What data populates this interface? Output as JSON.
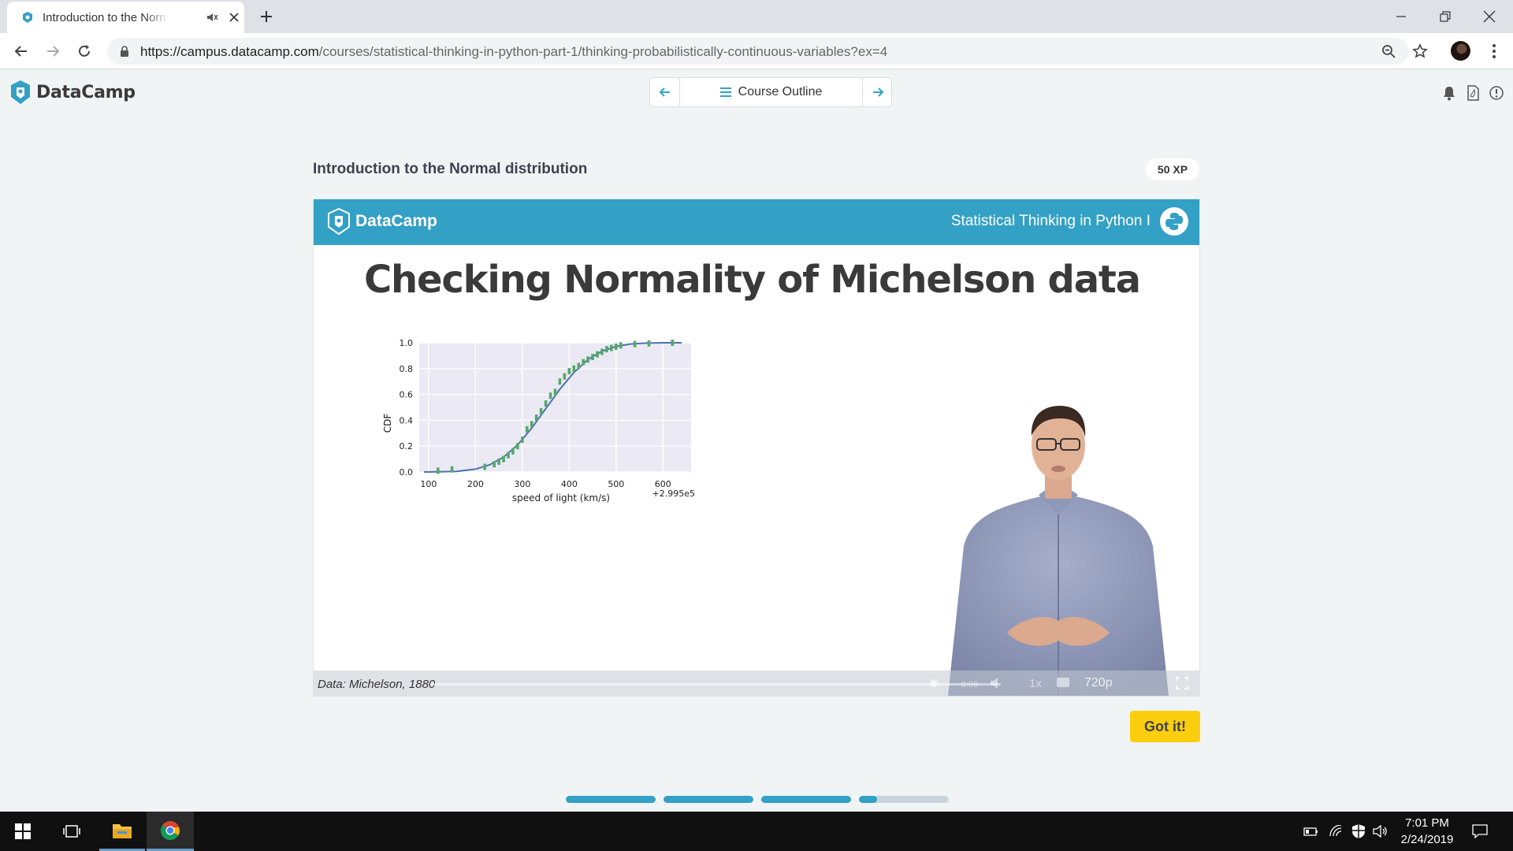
{
  "browser": {
    "tab_title": "Introduction to the Normal distribution",
    "url_host": "https://campus.datacamp.com",
    "url_path": "/courses/statistical-thinking-in-python-part-1/thinking-probabilistically-continuous-variables?ex=4"
  },
  "site": {
    "logo_text": "DataCamp",
    "course_outline_label": "Course Outline"
  },
  "exercise": {
    "title": "Introduction to the Normal distribution",
    "xp": "50 XP",
    "got_it_label": "Got it!"
  },
  "video": {
    "banner_logo": "DataCamp",
    "course_name": "Statistical Thinking in Python I",
    "slide_title": "Checking Normality of Michelson data",
    "source_caption": "Data: Michelson, 1880",
    "time": "-0:09",
    "speed": "1x",
    "quality": "720p"
  },
  "chart_data": {
    "type": "line",
    "title": "",
    "xlabel": "speed of light (km/s)",
    "ylabel": "CDF",
    "offset_label": "+2.995e5",
    "xlim": [
      80,
      660
    ],
    "ylim": [
      0,
      1
    ],
    "x_ticks": [
      100,
      200,
      300,
      400,
      500,
      600
    ],
    "y_ticks": [
      "0.0",
      "0.2",
      "0.4",
      "0.6",
      "0.8",
      "1.0"
    ],
    "grid": true,
    "series": [
      {
        "kind": "theoretical-cdf-line",
        "color": "#4c72b0",
        "x": [
          90,
          120,
          160,
          200,
          230,
          260,
          290,
          320,
          350,
          380,
          410,
          440,
          470,
          500,
          530,
          560,
          600,
          640
        ],
        "y": [
          0.0,
          0.001,
          0.005,
          0.022,
          0.055,
          0.115,
          0.21,
          0.34,
          0.49,
          0.64,
          0.77,
          0.87,
          0.935,
          0.972,
          0.99,
          0.997,
          1.0,
          1.0
        ]
      },
      {
        "kind": "ecdf-points",
        "color": "#55a868",
        "x": [
          120,
          150,
          220,
          240,
          250,
          260,
          270,
          280,
          290,
          300,
          310,
          320,
          330,
          340,
          350,
          360,
          370,
          380,
          390,
          400,
          410,
          420,
          430,
          440,
          450,
          460,
          470,
          480,
          490,
          500,
          510,
          540,
          570,
          620
        ],
        "y": [
          0.01,
          0.02,
          0.04,
          0.06,
          0.08,
          0.1,
          0.13,
          0.16,
          0.2,
          0.25,
          0.33,
          0.37,
          0.42,
          0.47,
          0.53,
          0.59,
          0.62,
          0.7,
          0.74,
          0.78,
          0.8,
          0.82,
          0.85,
          0.87,
          0.89,
          0.91,
          0.93,
          0.95,
          0.96,
          0.97,
          0.98,
          0.99,
          0.995,
          1.0
        ]
      }
    ]
  },
  "lesson_progress": [
    1,
    1,
    1,
    0.2
  ],
  "taskbar": {
    "time": "7:01 PM",
    "date": "2/24/2019"
  },
  "colors": {
    "accent": "#33a0c5",
    "cta": "#fcce0d",
    "text_dark": "#3d4251"
  }
}
